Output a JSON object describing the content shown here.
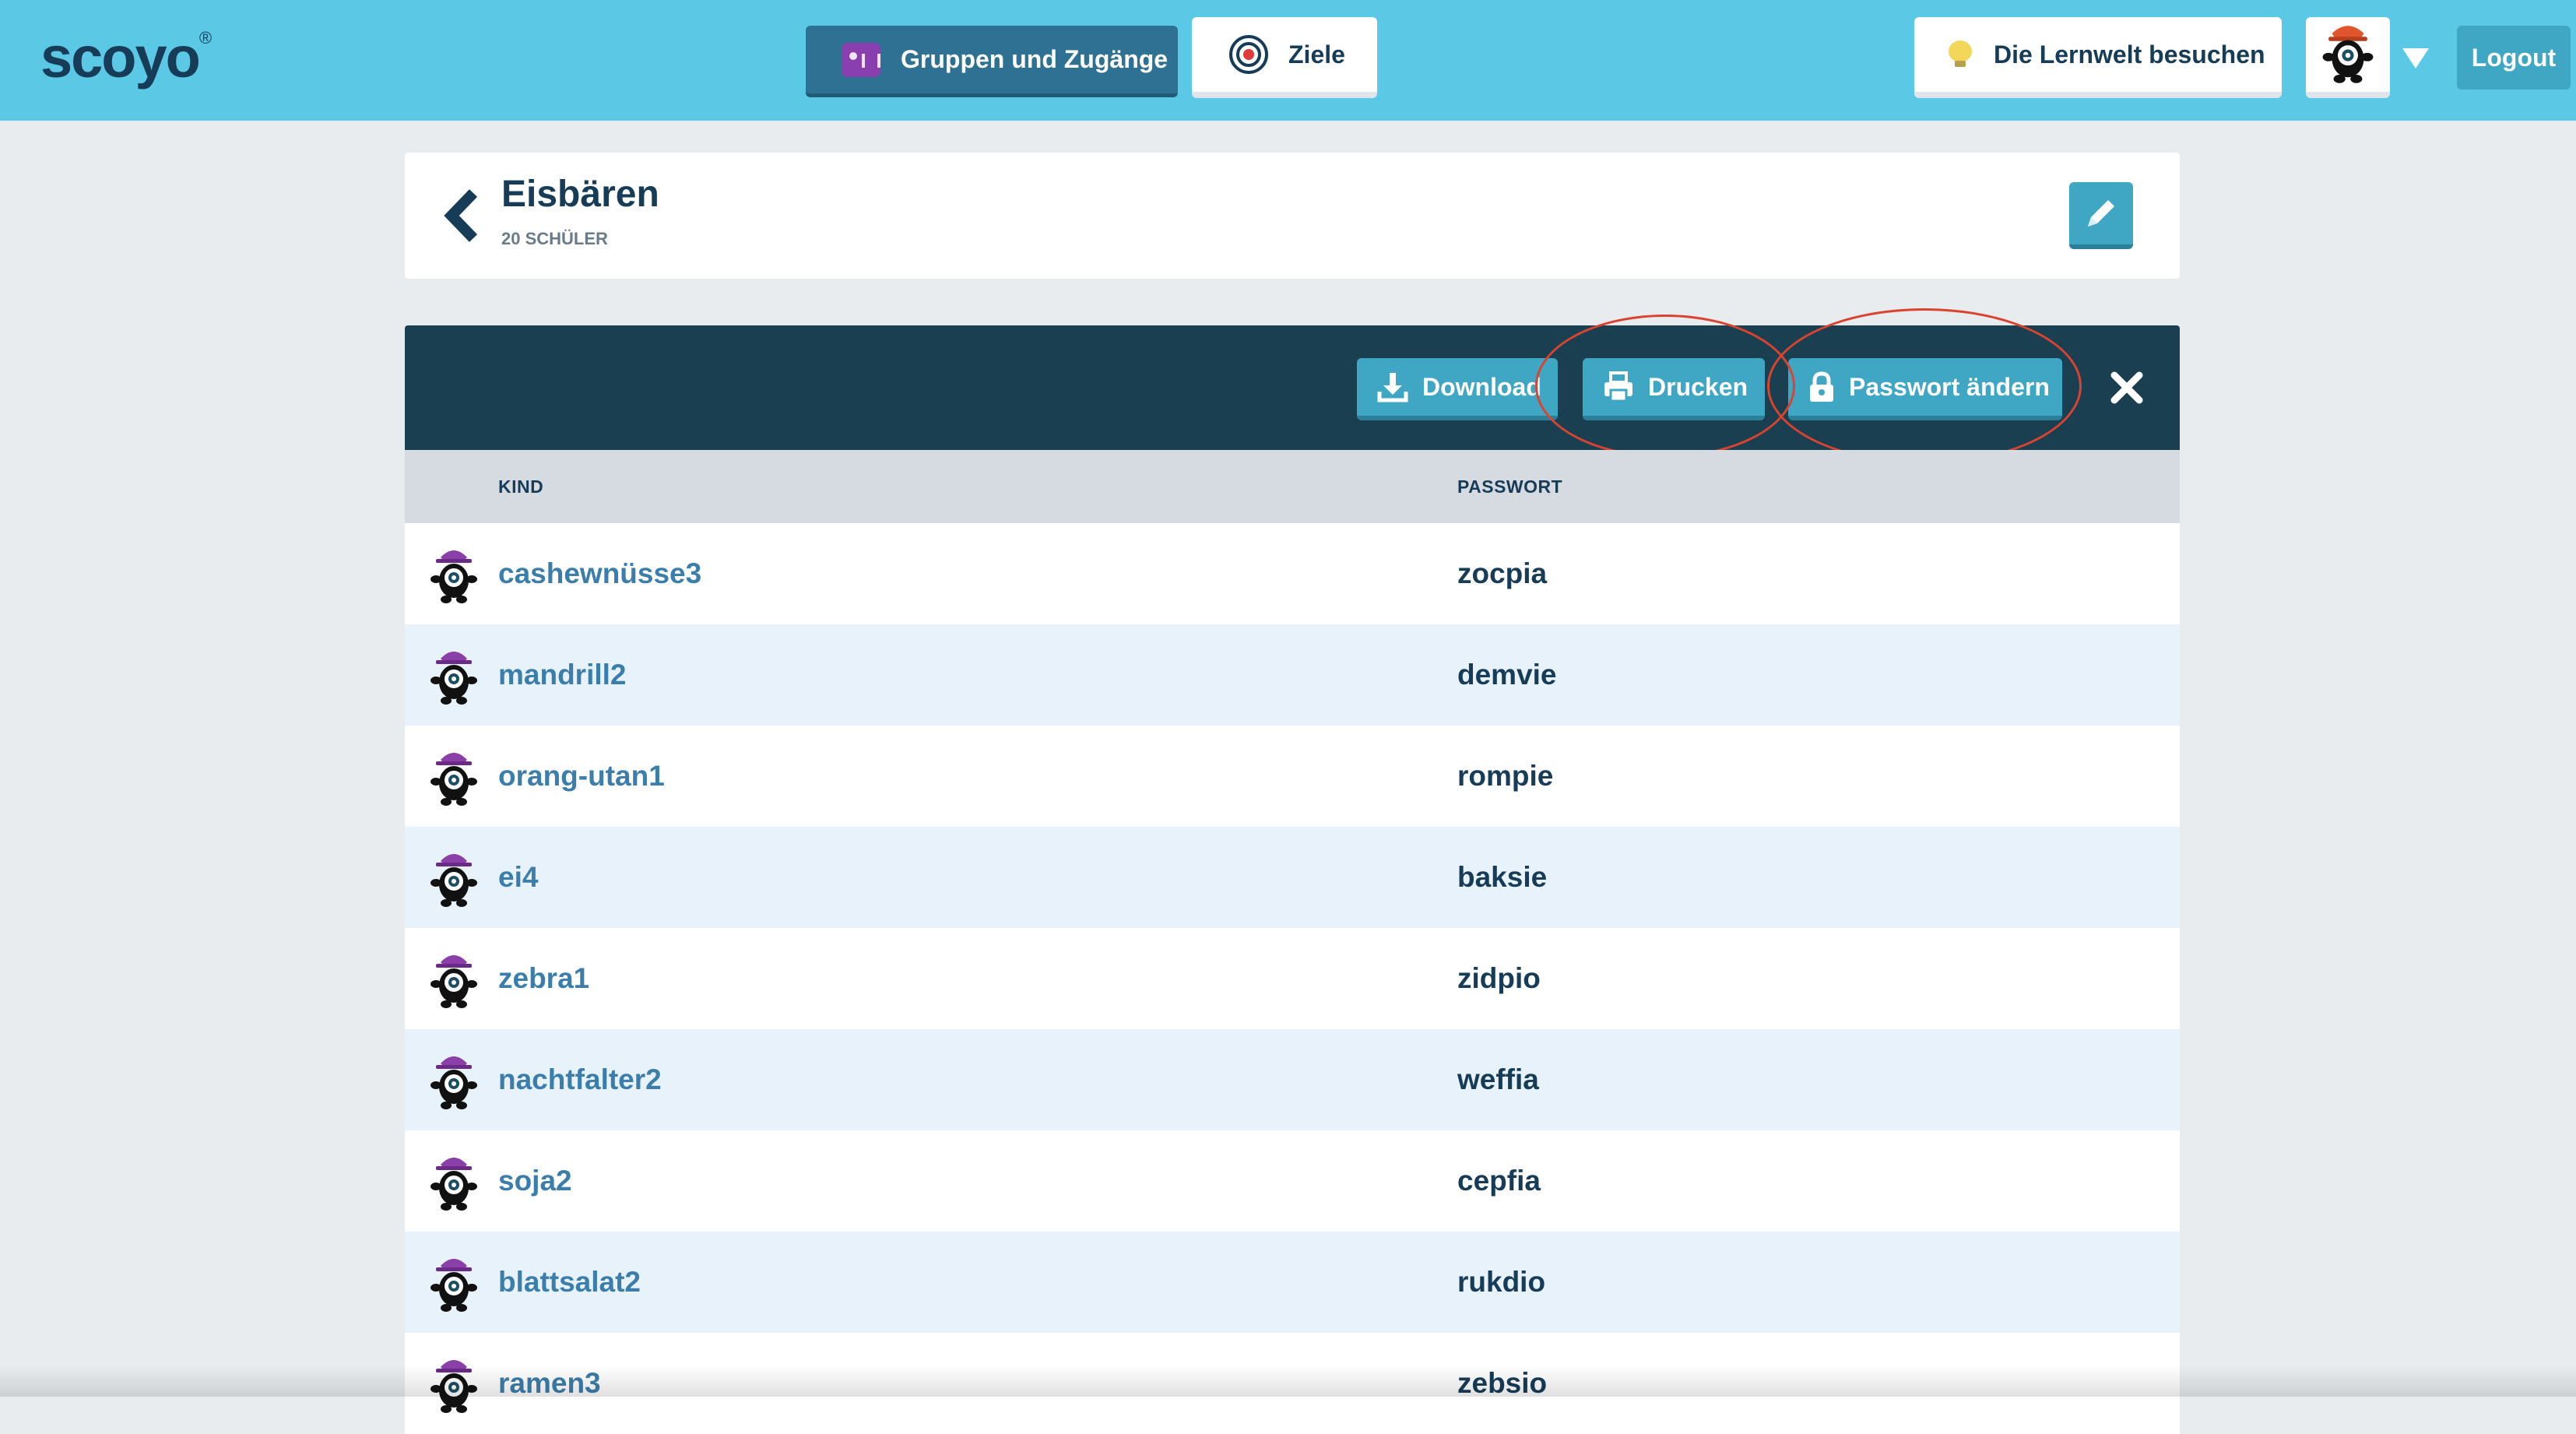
{
  "header": {
    "logo": "scoyo",
    "logo_mark": "®",
    "nav_groups_label": "Gruppen und Zugänge",
    "nav_goals_label": "Ziele",
    "lernwelt_label": "Die Lernwelt besuchen",
    "logout_label": "Logout"
  },
  "group": {
    "title": "Eisbären",
    "subtitle": "20 SCHÜLER"
  },
  "actions": {
    "download_label": "Download",
    "print_label": "Drucken",
    "password_label": "Passwort ändern"
  },
  "table": {
    "columns": [
      "KIND",
      "PASSWORT"
    ],
    "rows": [
      {
        "kind": "cashewnüsse3",
        "password": "zocpia"
      },
      {
        "kind": "mandrill2",
        "password": "demvie"
      },
      {
        "kind": "orang-utan1",
        "password": "rompie"
      },
      {
        "kind": "ei4",
        "password": "baksie"
      },
      {
        "kind": "zebra1",
        "password": "zidpio"
      },
      {
        "kind": "nachtfalter2",
        "password": "weffia"
      },
      {
        "kind": "soja2",
        "password": "cepfia"
      },
      {
        "kind": "blattsalat2",
        "password": "rukdio"
      },
      {
        "kind": "ramen3",
        "password": "zebsio"
      }
    ]
  },
  "icons": {
    "nav_groups": "group-chart-icon",
    "nav_goals": "target-icon",
    "lernwelt": "lightbulb-icon",
    "avatar": "scoyo-monster-avatar-icon",
    "back": "chevron-left-icon",
    "edit": "pencil-icon",
    "download": "download-icon",
    "print": "printer-icon",
    "password": "lock-icon",
    "close": "close-icon"
  },
  "colors": {
    "topbar": "#5bc8e6",
    "primary_dark": "#173c58",
    "accent": "#3fa6c4",
    "action_bar": "#1a3f51",
    "link": "#3c7eab",
    "row_alt": "#e8f2fa",
    "annotation": "#d9432f"
  }
}
